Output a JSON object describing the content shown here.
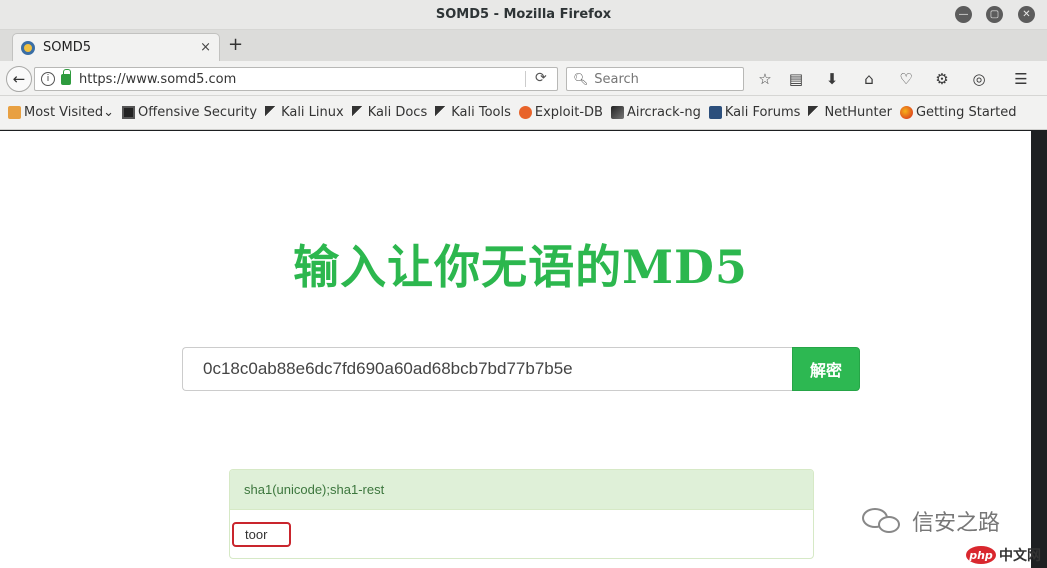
{
  "window": {
    "title": "SOMD5 - Mozilla Firefox"
  },
  "tabs": [
    {
      "label": "SOMD5",
      "close": "×"
    }
  ],
  "newtab_label": "+",
  "navbar": {
    "url": "https://www.somd5.com",
    "search_placeholder": "Search"
  },
  "bookmarks": [
    {
      "label": "Most Visited",
      "icon": "folder-icon"
    },
    {
      "label": "Offensive Security",
      "icon": "offsec-icon"
    },
    {
      "label": "Kali Linux",
      "icon": "kali-dragon-icon"
    },
    {
      "label": "Kali Docs",
      "icon": "kali-dragon-icon"
    },
    {
      "label": "Kali Tools",
      "icon": "kali-dragon-icon"
    },
    {
      "label": "Exploit-DB",
      "icon": "exploitdb-icon"
    },
    {
      "label": "Aircrack-ng",
      "icon": "aircrack-icon"
    },
    {
      "label": "Kali Forums",
      "icon": "kali-forums-icon"
    },
    {
      "label": "NetHunter",
      "icon": "kali-dragon-icon"
    },
    {
      "label": "Getting Started",
      "icon": "firefox-icon"
    }
  ],
  "page": {
    "headline": "输入让你无语的MD5",
    "hash_value": "0c18c0ab88e6dc7fd690a60ad68bcb7bd77b7b5e",
    "decrypt_label": "解密",
    "result_type": "sha1(unicode);sha1-rest",
    "result_value": "toor"
  },
  "watermarks": {
    "wechat_text": "信安之路",
    "php_badge": "php",
    "php_text": "中文网"
  },
  "colors": {
    "accent_green": "#2cb74e",
    "highlight_red": "#c9252d",
    "result_header_bg": "#dff0d8"
  }
}
